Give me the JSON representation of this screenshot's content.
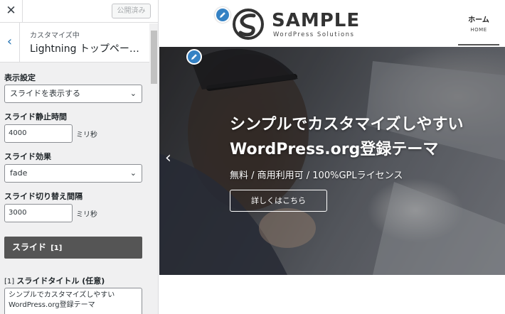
{
  "topbar": {
    "close_icon": "close-icon",
    "publish_label": "公開済み"
  },
  "panel": {
    "back_icon": "chevron-left-icon",
    "crumb": "カスタマイズ中",
    "title": "Lightning トップペー…"
  },
  "controls": {
    "display": {
      "label": "表示設定",
      "value": "スライドを表示する"
    },
    "interval": {
      "label": "スライド静止時間",
      "value": "4000",
      "unit": "ミリ秒"
    },
    "effect": {
      "label": "スライド効果",
      "value": "fade"
    },
    "speed": {
      "label": "スライド切り替え間隔",
      "value": "3000",
      "unit": "ミリ秒"
    }
  },
  "slide_section": {
    "label": "スライド",
    "index": "[1]"
  },
  "slide_title": {
    "prefix": "[1]",
    "label": "スライドタイトル (任意)",
    "line1": "シンプルでカスタマイズしやすい",
    "line2": "WordPress.org登録テーマ"
  },
  "site": {
    "logo_text": "SAMPLE",
    "logo_sub": "WordPress Solutions",
    "nav_home_jp": "ホーム",
    "nav_home_en": "HOME"
  },
  "hero": {
    "title_line1": "シンプルでカスタマイズしやすい",
    "title_line2": "WordPress.org登録テーマ",
    "subtitle": "無料 / 商用利用可 / 100%GPLライセンス",
    "button": "詳しくはこちら",
    "prev_icon": "chevron-left-icon"
  },
  "colors": {
    "accent": "#3582c4",
    "slide_bar": "#555555",
    "link": "#2271b1"
  }
}
